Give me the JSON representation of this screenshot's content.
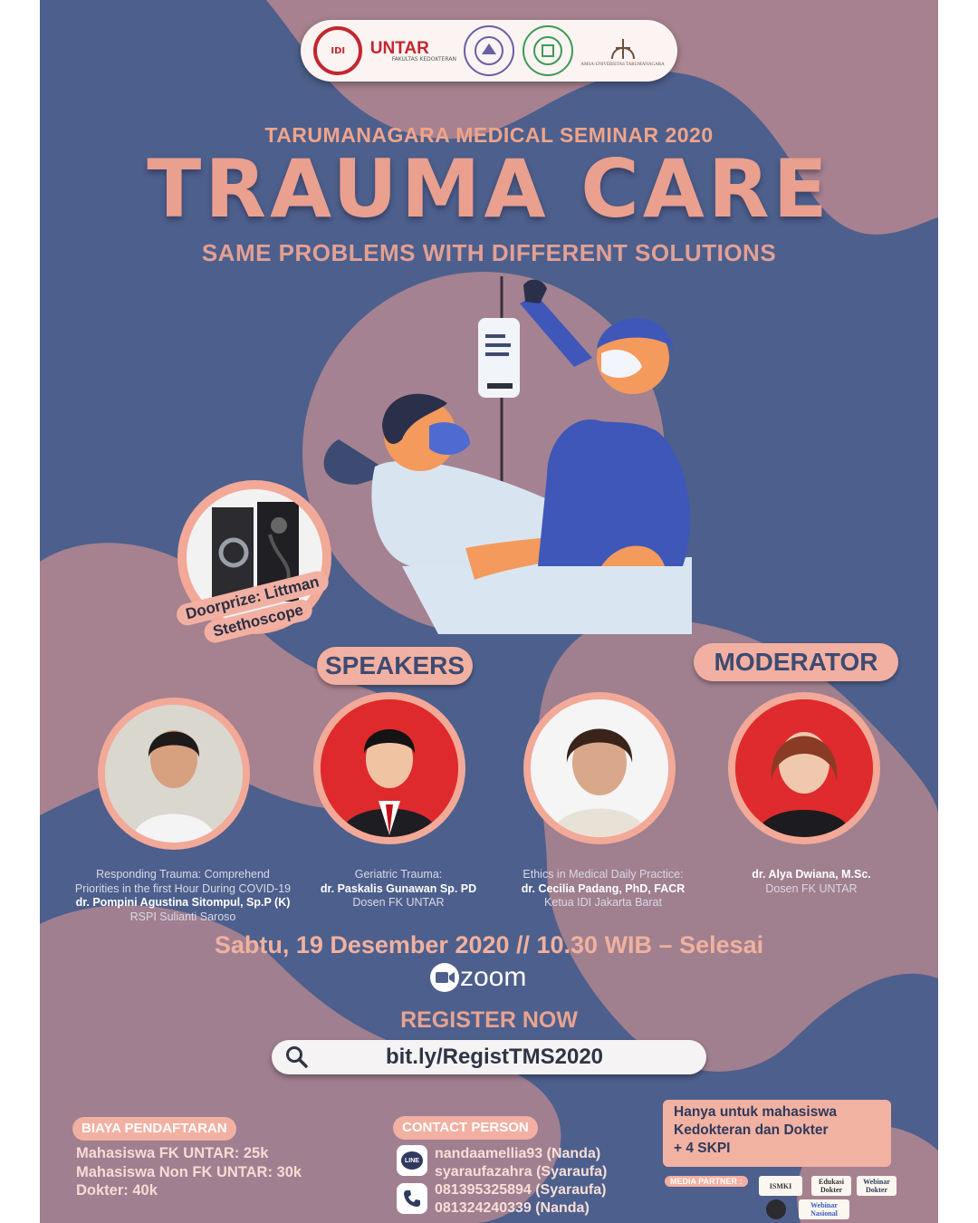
{
  "logos": {
    "idi": "IDI",
    "untar": "UNTAR",
    "untar_sub": "FAKULTAS KEDOKTERAN",
    "seal1": "seal-1",
    "seal2": "seal-2",
    "amsa": "AMSA-UNIVERSITAS TARUMANAGARA"
  },
  "header": {
    "seminar": "TARUMANAGARA MEDICAL SEMINAR 2020",
    "title": "TRAUMA CARE",
    "subtitle": "SAME PROBLEMS WITH DIFFERENT SOLUTIONS"
  },
  "doorprize": {
    "line1": "Doorprize: Littman",
    "line2": "Stethoscope"
  },
  "sections": {
    "speakers": "SPEAKERS",
    "moderator": "MODERATOR"
  },
  "people": [
    {
      "topic1": "Responding Trauma: Comprehend",
      "topic2": "Priorities in the first Hour During COVID-19",
      "name": "dr. Pompini Agustina Sitompul, Sp.P (K)",
      "affil": "RSPI Sulianti Saroso"
    },
    {
      "topic1": "Geriatric Trauma:",
      "name": "dr. Paskalis Gunawan Sp. PD",
      "affil": "Dosen FK UNTAR"
    },
    {
      "topic1": "Ethics in Medical Daily Practice:",
      "name": "dr. Cecilia Padang, PhD, FACR",
      "affil": "Ketua IDI Jakarta Barat"
    },
    {
      "name": "dr. Alya Dwiana, M.Sc.",
      "affil": "Dosen FK UNTAR"
    }
  ],
  "event": {
    "date": "Sabtu, 19 Desember 2020 // 10.30 WIB – Selesai",
    "platform": "zoom"
  },
  "register": {
    "label": "REGISTER NOW",
    "link": "bit.ly/RegistTMS2020"
  },
  "fees": {
    "label": "BIAYA PENDAFTARAN",
    "items": [
      "Mahasiswa FK UNTAR: 25k",
      "Mahasiswa Non FK UNTAR: 30k",
      "Dokter: 40k"
    ]
  },
  "contact": {
    "label": "CONTACT PERSON",
    "line_badge": "LINE",
    "line": [
      "nandaamellia93 (Nanda)",
      "syaraufazahra (Syaraufa)"
    ],
    "phone": [
      "081395325894 (Syaraufa)",
      "081324240339 (Nanda)"
    ]
  },
  "note": {
    "line1": "Hanya untuk mahasiswa",
    "line2": "Kedokteran dan Dokter",
    "line3": "+ 4 SKPI"
  },
  "media_partner": {
    "label": "MEDIA PARTNER :",
    "items": [
      "ISMKI",
      "Edukasi Dokter",
      "Webinar Dokter",
      "Webinar Nasional"
    ]
  },
  "colors": {
    "background": "#4d5f8c",
    "accent": "#f2b0a2",
    "title": "#e9a08e",
    "blob": "#a38190"
  }
}
